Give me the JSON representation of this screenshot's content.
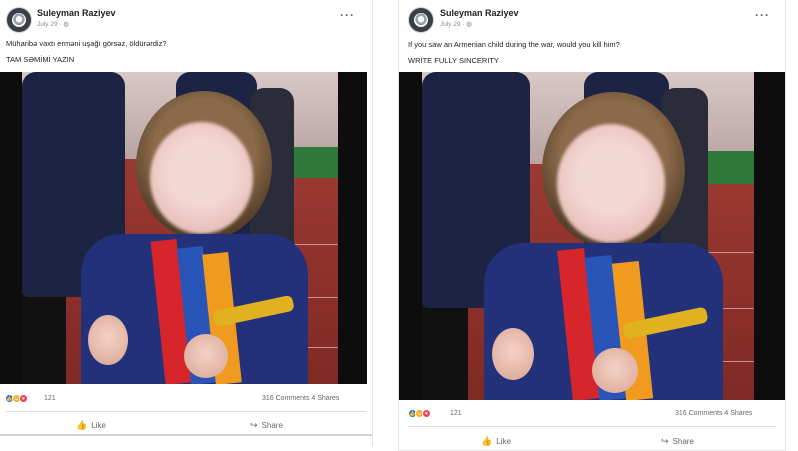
{
  "posts": [
    {
      "author": "Suleyman Raziyev",
      "meta": "July 29 · ",
      "caption_line1": "Müharibə vaxtı erməni uşağı görsəz, öldürərdiz?",
      "caption_line2": "TAM SƏMİMİ YAZIN",
      "reaction_count": "121",
      "comments_shares": "316 Comments  4 Shares",
      "like_label": "Like",
      "share_label": "Share"
    },
    {
      "author": "Suleyman Raziyev",
      "meta": "July 29 · ",
      "caption_line1": "If you saw an Armenian child during the war, would you kill him?",
      "caption_line2": "WRITE FULLY SINCERITY",
      "reaction_count": "121",
      "comments_shares": "316 Comments  4 Shares",
      "like_label": "Like",
      "share_label": "Share"
    }
  ],
  "icons": {
    "more": "more-options-icon",
    "like": "thumbs-up-icon",
    "share": "share-arrow-icon",
    "globe": "globe-icon",
    "reactions": [
      "like-reaction-icon",
      "haha-reaction-icon",
      "love-reaction-icon"
    ]
  },
  "colors": {
    "like_blue": "#1877f2",
    "haha_yellow": "#f7b125",
    "love_red": "#f33e58",
    "flag_red": "#d7262b",
    "flag_blue": "#2a55b8",
    "flag_orange": "#f09a1f"
  }
}
